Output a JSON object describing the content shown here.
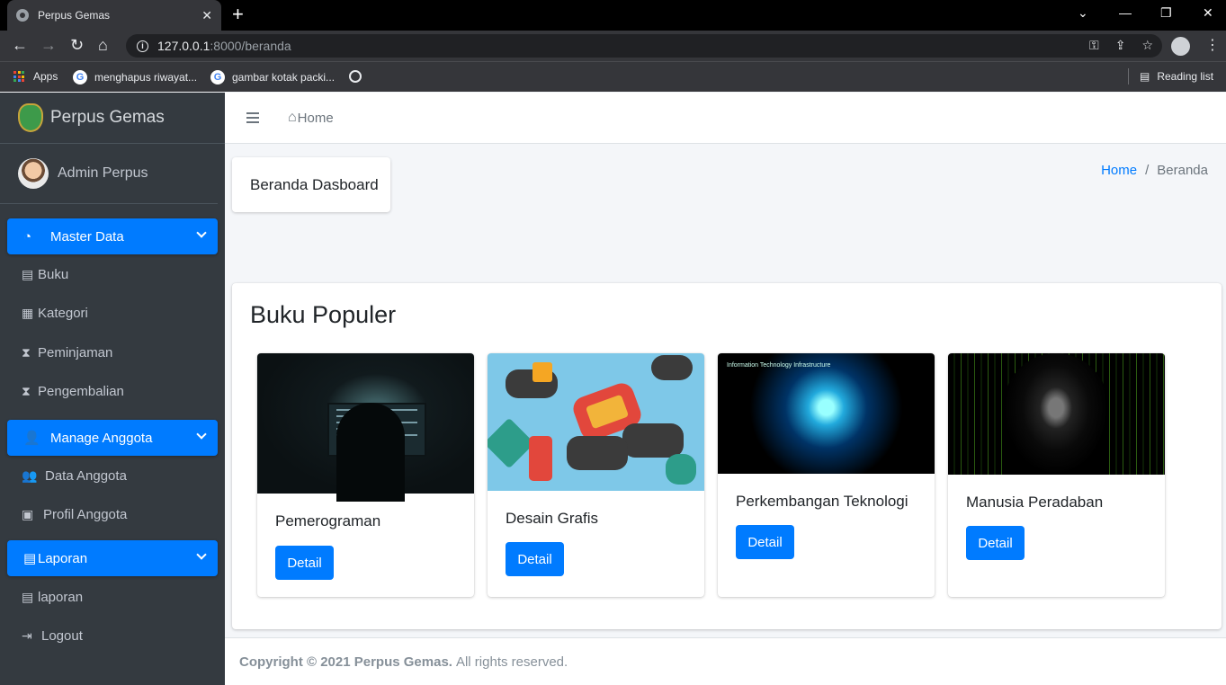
{
  "browser": {
    "tab_title": "Perpus Gemas",
    "url_host": "127.0.0.1",
    "url_path": ":8000/beranda",
    "bookmarks": [
      "Apps",
      "menghapus riwayat...",
      "gambar kotak packi..."
    ],
    "reading_list": "Reading list"
  },
  "sidebar": {
    "brand": "Perpus Gemas",
    "user": "Admin Perpus",
    "groups": [
      {
        "label": "Master Data",
        "icon": "dashboard-gauge-icon"
      },
      {
        "label": "Manage Anggota",
        "icon": "user-cog-icon"
      },
      {
        "label": "Laporan",
        "icon": "file-icon"
      }
    ],
    "items": [
      {
        "label": "Buku",
        "icon": "book-icon"
      },
      {
        "label": "Kategori",
        "icon": "clipboard-icon"
      },
      {
        "label": "Peminjaman",
        "icon": "hourglass-icon"
      },
      {
        "label": "Pengembalian",
        "icon": "hourglass-icon"
      },
      {
        "label": "Data Anggota",
        "icon": "users-icon"
      },
      {
        "label": "Profil Anggota",
        "icon": "id-card-icon"
      },
      {
        "label": "laporan",
        "icon": "file-icon"
      },
      {
        "label": "Logout",
        "icon": "sign-out-icon"
      }
    ]
  },
  "header": {
    "home": "Home"
  },
  "page": {
    "title": "Beranda Dasboard",
    "breadcrumb": [
      "Home",
      "Beranda"
    ]
  },
  "popular": {
    "heading": "Buku Populer",
    "books": [
      {
        "title": "Pemerograman",
        "button": "Detail"
      },
      {
        "title": "Desain Grafis",
        "button": "Detail"
      },
      {
        "title": "Perkembangan Teknologi",
        "button": "Detail"
      },
      {
        "title": "Manusia Peradaban",
        "button": "Detail"
      }
    ],
    "image_caption_tech": "Information Technology Infrastructure"
  },
  "footer": {
    "copyright": "Copyright © 2021 Perpus Gemas.",
    "rights": "All rights reserved."
  },
  "colors": {
    "primary": "#007bff",
    "sidebar": "#343a40",
    "content_bg": "#f4f6f9"
  }
}
